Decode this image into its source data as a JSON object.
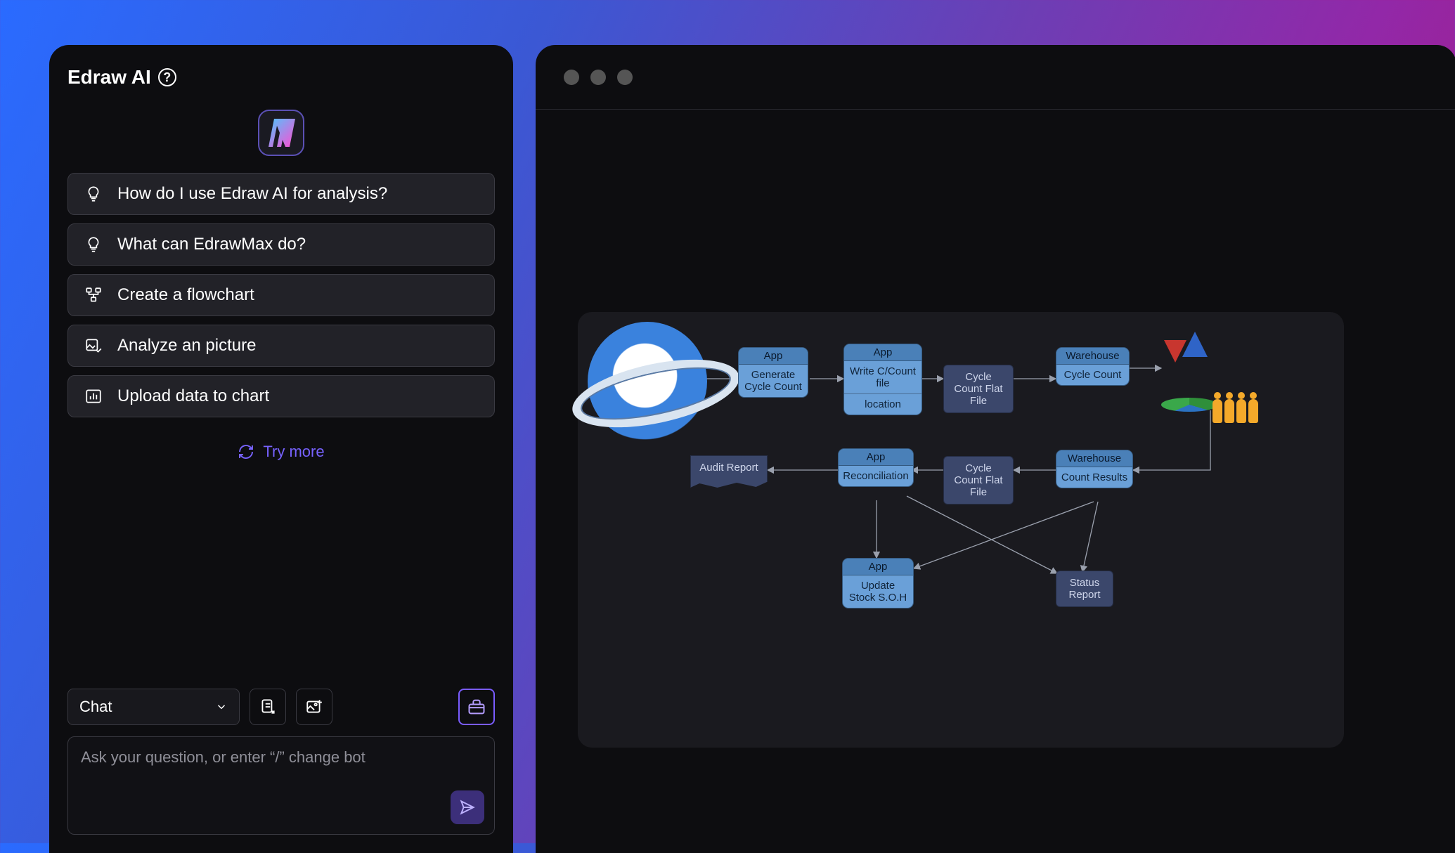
{
  "sidebar": {
    "title": "Edraw AI",
    "suggestions": [
      {
        "label": "How do I use Edraw AI for analysis?"
      },
      {
        "label": "What can EdrawMax do?"
      },
      {
        "label": "Create a flowchart"
      },
      {
        "label": "Analyze an picture"
      },
      {
        "label": "Upload data to chart"
      }
    ],
    "try_more": "Try more",
    "mode_label": "Chat",
    "prompt_placeholder": "Ask your question, or enter “/” change bot"
  },
  "diagram": {
    "nodes": {
      "n1": {
        "header": "App",
        "body": "Generate Cycle Count"
      },
      "n2": {
        "header": "App",
        "body": "Write C/Count file",
        "footer": "location"
      },
      "n3": {
        "label": "Cycle Count Flat File"
      },
      "n4": {
        "header": "Warehouse",
        "body": "Cycle Count"
      },
      "n5": {
        "header": "Warehouse",
        "body": "Count Results"
      },
      "n6": {
        "label": "Cycle Count Flat File"
      },
      "n7": {
        "header": "App",
        "body": "Reconciliation"
      },
      "n8": {
        "label": "Audit Report"
      },
      "n9": {
        "header": "App",
        "body": "Update Stock S.O.H"
      },
      "n10": {
        "label": "Status Report"
      }
    }
  }
}
